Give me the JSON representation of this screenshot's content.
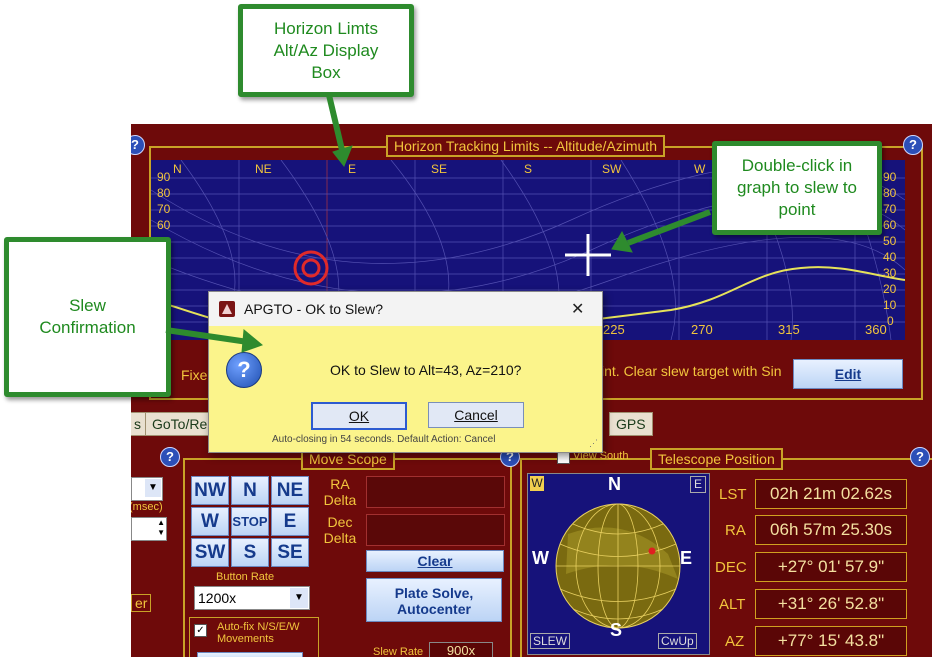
{
  "horizon": {
    "title": "Horizon Tracking Limits -- Altitude/Azimuth",
    "compass": [
      "N",
      "NE",
      "E",
      "SE",
      "S",
      "SW",
      "W"
    ],
    "alt_left": [
      "90",
      "80",
      "70",
      "60"
    ],
    "alt_right": [
      "90",
      "80",
      "70",
      "60",
      "50",
      "40",
      "30",
      "20",
      "10",
      "0"
    ],
    "az_ticks": [
      "225",
      "270",
      "315",
      "360"
    ],
    "partial_left": "Fixe",
    "partial_right": "int. Clear slew target with Sin",
    "edit_label": "Edit"
  },
  "tabs": [
    "s",
    "GoTo/Re",
    "GPS"
  ],
  "move_scope": {
    "title": "Move Scope",
    "buttons": [
      "NW",
      "N",
      "NE",
      "W",
      "STOP",
      "E",
      "SW",
      "S",
      "SE"
    ],
    "ra_delta": "RA\nDelta",
    "dec_delta": "Dec\nDelta",
    "clear_label": "Clear",
    "plate_solve_label": "Plate Solve,\nAutocenter",
    "button_rate_label": "Button Rate",
    "button_rate_value": "1200x",
    "autofix_label": "Auto-fix N/S/E/W\nMovements",
    "slew_rate_label": "Slew Rate",
    "slew_rate_value": "900x"
  },
  "left_panel": {
    "msec_label": "(msec)",
    "partial_er": "er"
  },
  "telescope": {
    "title": "Telescope Position",
    "view_south": "View South",
    "compass": {
      "n": "N",
      "s": "S",
      "e": "E",
      "w": "W",
      "corner_w": "W",
      "corner_e": "E"
    },
    "slew_badge": "SLEW",
    "cwup_badge": "CwUp",
    "rows": [
      {
        "label": "LST",
        "value": "02h 21m 02.62s"
      },
      {
        "label": "RA",
        "value": "06h 57m 25.30s"
      },
      {
        "label": "DEC",
        "value": "+27° 01' 57.9\""
      },
      {
        "label": "ALT",
        "value": "+31° 26' 52.8\""
      },
      {
        "label": "AZ",
        "value": "+77° 15' 43.8\""
      }
    ]
  },
  "dialog": {
    "title": "APGTO - OK to Slew?",
    "message": "OK to Slew to Alt=43, Az=210?",
    "ok_label": "OK",
    "cancel_label": "Cancel",
    "footer": "Auto-closing in 54 seconds. Default Action: Cancel",
    "close_glyph": "✕"
  },
  "callouts": {
    "horizon_box": "Horizon Limts\nAlt/Az Display\nBox",
    "double_click": "Double-click in\ngraph to slew to\npoint",
    "slew_confirm": "Slew\nConfirmation"
  },
  "colors": {
    "callout_green": "#2e8b2e",
    "panel_red": "#6e0a0a",
    "gold": "#f2c53d",
    "chart_blue": "#16127a",
    "dialog_yellow": "#fbf48b"
  }
}
